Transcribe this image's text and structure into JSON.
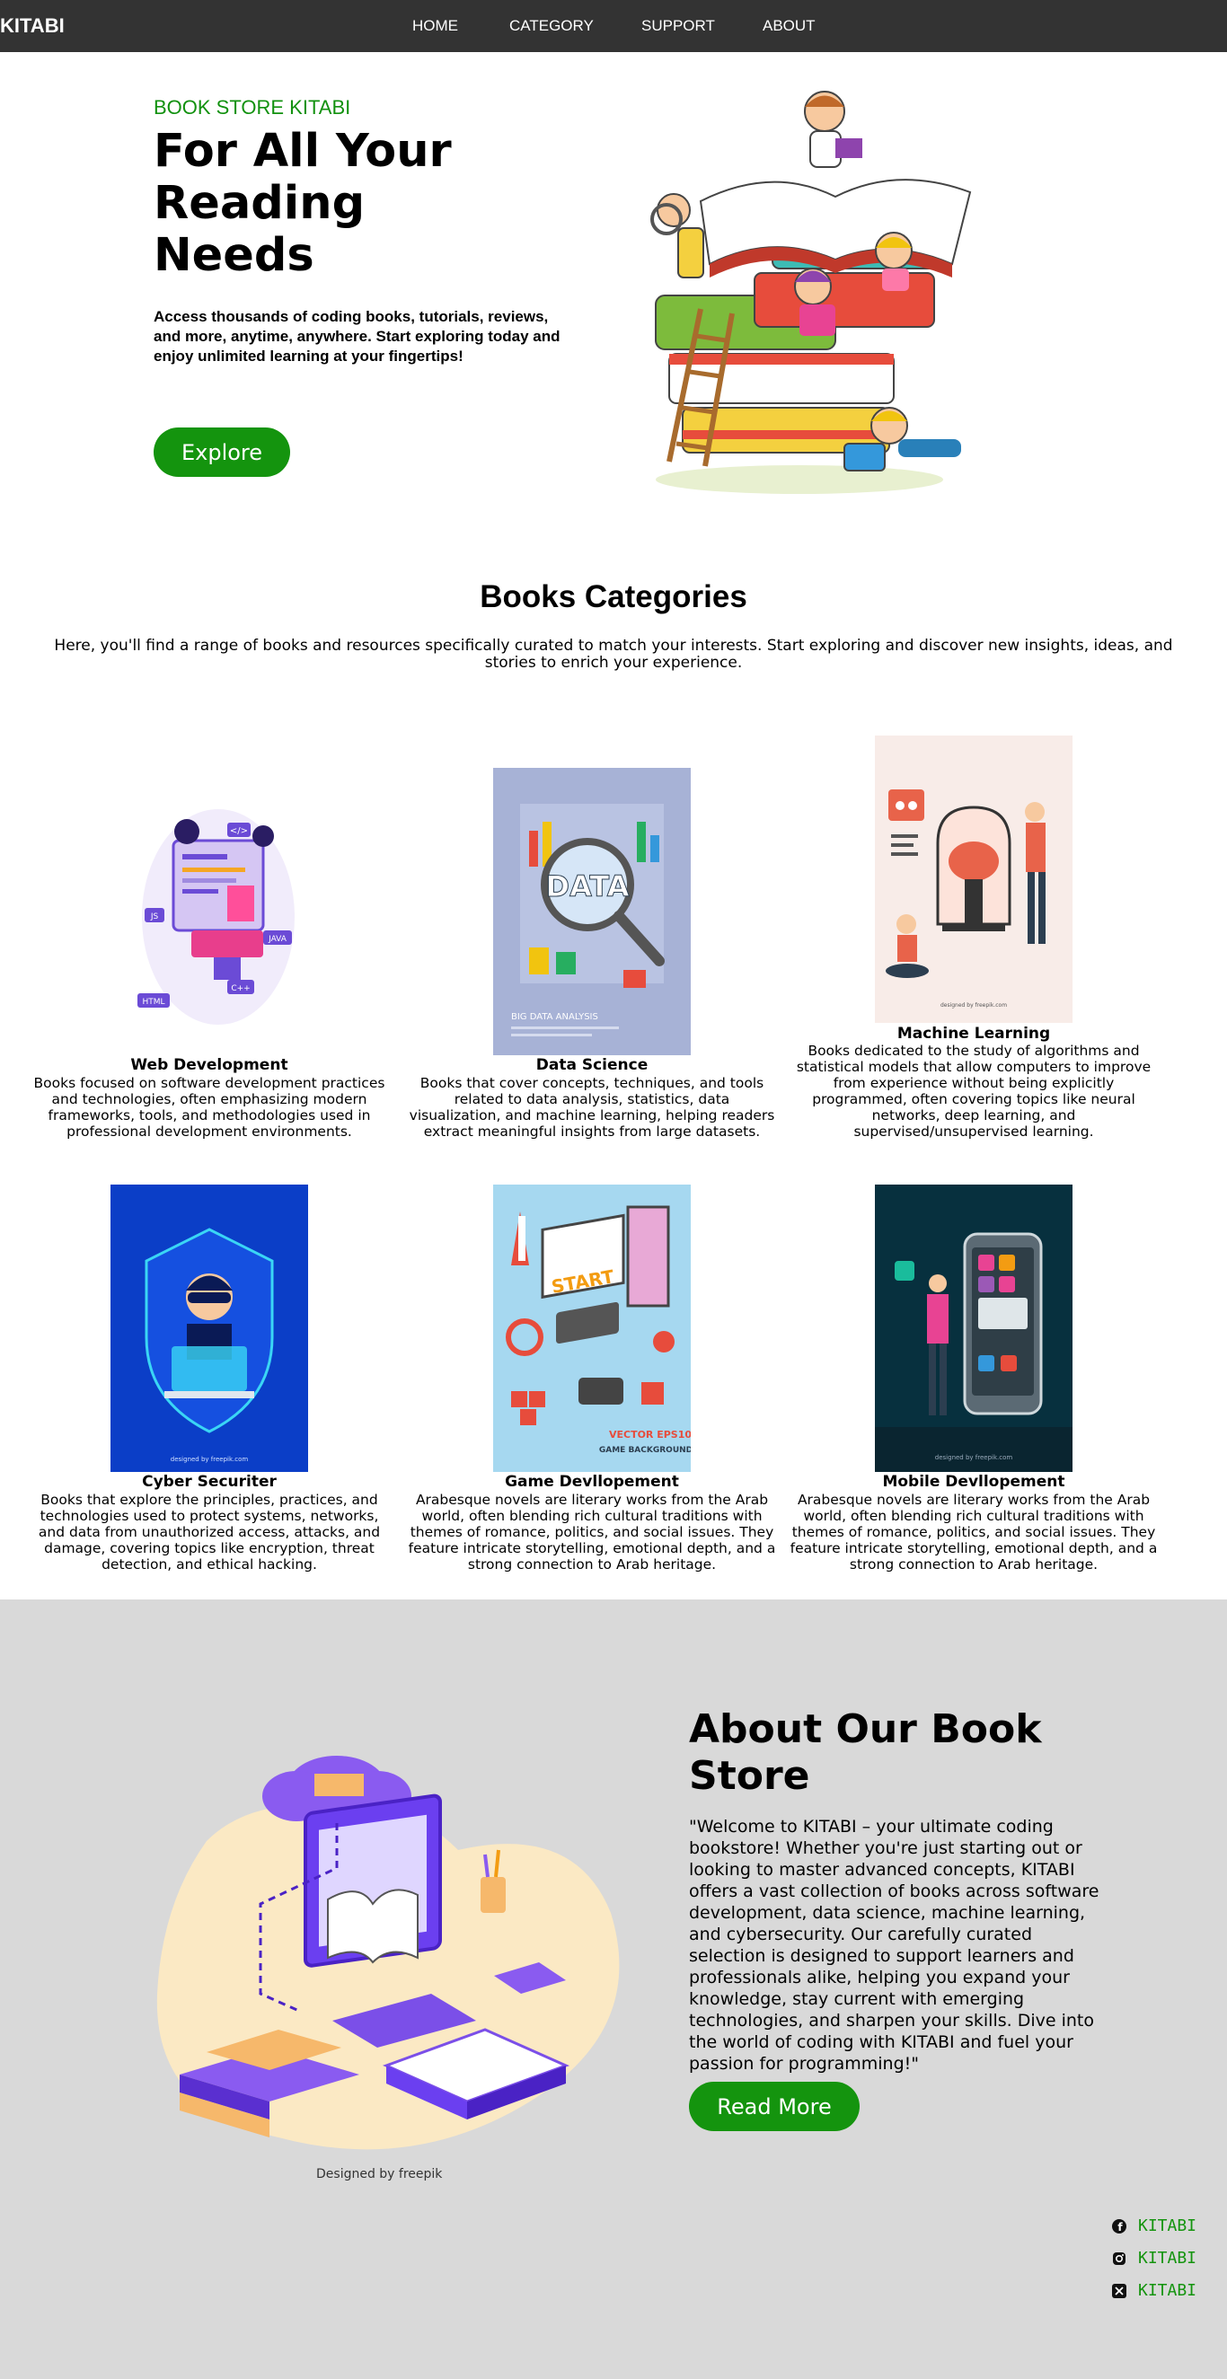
{
  "nav": {
    "brand": "KITABI",
    "links": [
      "HOME",
      "CATEGORY",
      "SUPPORT",
      "ABOUT"
    ]
  },
  "hero": {
    "kicker": "BOOK STORE KITABI",
    "title": "For All Your Reading Needs",
    "description": "Access thousands of coding books, tutorials, reviews, and more, anytime, anywhere. Start exploring today and enjoy unlimited learning at your fingertips!",
    "button": "Explore"
  },
  "categories": {
    "title": "Books Categories",
    "subtitle": "Here, you'll find a range of books and resources specifically curated to match your interests. Start exploring and discover new insights, ideas, and stories to enrich your experience.",
    "items": [
      {
        "name": "Web Development",
        "description": "Books focused on software development practices and technologies, often emphasizing modern frameworks, tools, and methodologies used in professional development environments."
      },
      {
        "name": "Data Science",
        "description": "Books that cover concepts, techniques, and tools related to data analysis, statistics, data visualization, and machine learning, helping readers extract meaningful insights from large datasets."
      },
      {
        "name": "Machine Learning",
        "description": "Books dedicated to the study of algorithms and statistical models that allow computers to improve from experience without being explicitly programmed, often covering topics like neural networks, deep learning, and supervised/unsupervised learning."
      },
      {
        "name": "Cyber Securiter",
        "description": "Books that explore the principles, practices, and technologies used to protect systems, networks, and data from unauthorized access, attacks, and damage, covering topics like encryption, threat detection, and ethical hacking."
      },
      {
        "name": "Game Devllopement",
        "description": "Arabesque novels are literary works from the Arab world, often blending rich cultural traditions with themes of romance, politics, and social issues. They feature intricate storytelling, emotional depth, and a strong connection to Arab heritage."
      },
      {
        "name": "Mobile Devllopement",
        "description": "Arabesque novels are literary works from the Arab world, often blending rich cultural traditions with themes of romance, politics, and social issues. They feature intricate storytelling, emotional depth, and a strong connection to Arab heritage."
      }
    ],
    "image_texts": {
      "data_word": "DATA",
      "data_caption": "BIG DATA ANALYSIS",
      "designed_by": "designed by freepik.com",
      "game_start": "START",
      "game_vector": "VECTOR EPS10",
      "game_bg": "GAME BACKGROUND",
      "web_tags": [
        "JS",
        "JAVA",
        "HTML",
        "C++",
        "</>"
      ]
    }
  },
  "about": {
    "title": "About Our Book Store",
    "text": "\"Welcome to KITABI – your ultimate coding bookstore! Whether you're just starting out or looking to master advanced concepts, KITABI offers a vast collection of books across software development, data science, machine learning, and cybersecurity. Our carefully curated selection is designed to support learners and professionals alike, helping you expand your knowledge, stay current with emerging technologies, and sharpen your skills. Dive into the world of coding with KITABI and fuel your passion for programming!\"",
    "button": "Read More",
    "credit": "Designed by freepik"
  },
  "social": [
    {
      "icon": "facebook-icon",
      "label": "KITABI"
    },
    {
      "icon": "instagram-icon",
      "label": "KITABI"
    },
    {
      "icon": "x-icon",
      "label": "KITABI"
    }
  ],
  "colors": {
    "nav_bg": "#333333",
    "accent_green": "#14940e",
    "about_bg": "#d9d9d9"
  }
}
